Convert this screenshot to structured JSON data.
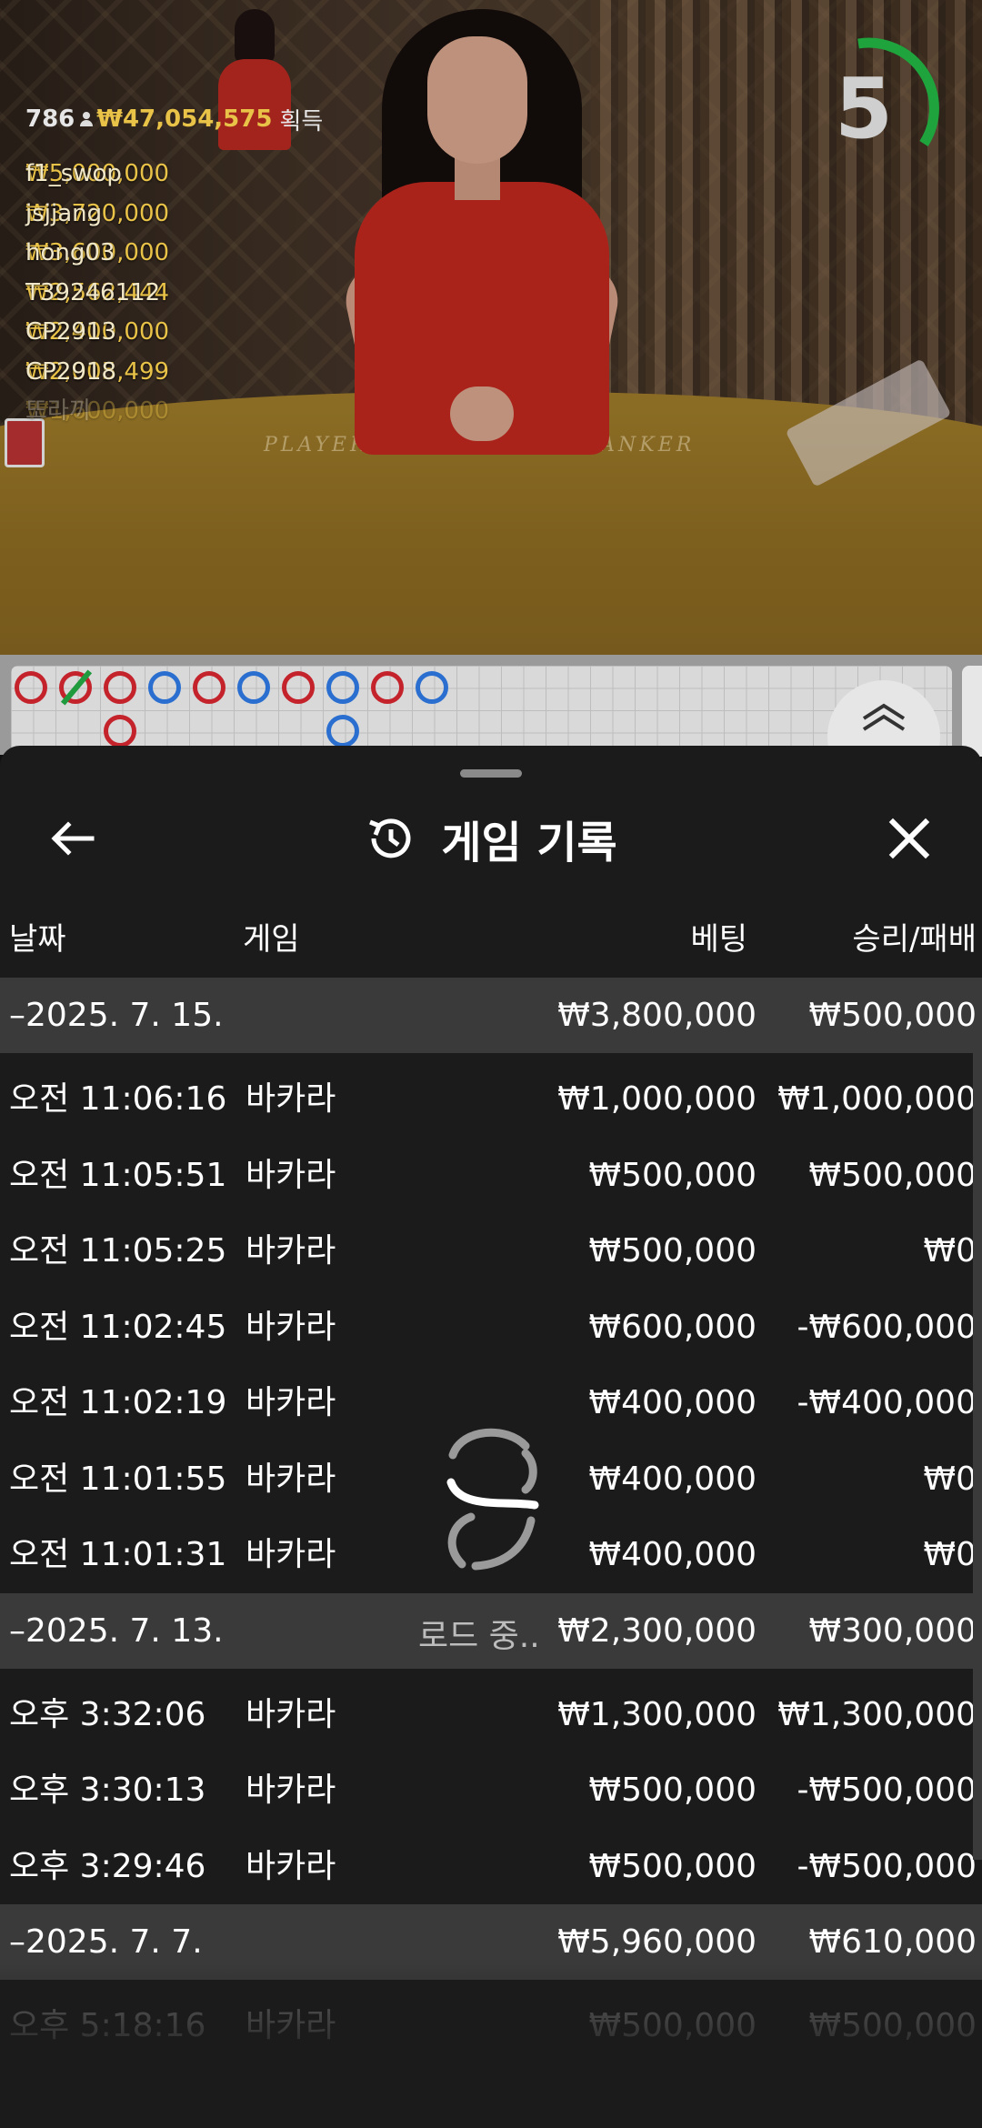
{
  "timer": {
    "value": "5"
  },
  "winners": {
    "count": "786",
    "total": "₩47,054,575",
    "gain_label": "획득",
    "list": [
      {
        "amount": "₩5,000,000",
        "name": "f1_swop"
      },
      {
        "amount": "₩3,720,000",
        "name": "jsjjang"
      },
      {
        "amount": "₩3,600,000",
        "name": "hong03"
      },
      {
        "amount": "₩2,562,444",
        "name": "T39246112"
      },
      {
        "amount": "₩2,400,000",
        "name": "CP2913"
      },
      {
        "amount": "₩2,005,499",
        "name": "CP2918"
      },
      {
        "amount": "₩1,600,000",
        "name": "또라끼"
      }
    ]
  },
  "table_labels": {
    "player": "PLAYER",
    "banker": "BANKER"
  },
  "sheet": {
    "title": "게임 기록",
    "columns": {
      "date": "날짜",
      "game": "게임",
      "bet": "베팅",
      "result": "승리/패배"
    },
    "loading": "로드 중..",
    "groups": [
      {
        "date": "–2025. 7. 15.",
        "bet": "₩3,800,000",
        "result": "₩500,000",
        "rows": [
          {
            "time": "오전 11:06:16",
            "game": "바카라",
            "bet": "₩1,000,000",
            "result": "₩1,000,000"
          },
          {
            "time": "오전 11:05:51",
            "game": "바카라",
            "bet": "₩500,000",
            "result": "₩500,000"
          },
          {
            "time": "오전 11:05:25",
            "game": "바카라",
            "bet": "₩500,000",
            "result": "₩0"
          },
          {
            "time": "오전 11:02:45",
            "game": "바카라",
            "bet": "₩600,000",
            "result": "-₩600,000"
          },
          {
            "time": "오전 11:02:19",
            "game": "바카라",
            "bet": "₩400,000",
            "result": "-₩400,000"
          },
          {
            "time": "오전 11:01:55",
            "game": "바카라",
            "bet": "₩400,000",
            "result": "₩0"
          },
          {
            "time": "오전 11:01:31",
            "game": "바카라",
            "bet": "₩400,000",
            "result": "₩0"
          }
        ]
      },
      {
        "date": "–2025. 7. 13.",
        "bet": "₩2,300,000",
        "result": "₩300,000",
        "rows": [
          {
            "time": "오후 3:32:06",
            "game": "바카라",
            "bet": "₩1,300,000",
            "result": "₩1,300,000"
          },
          {
            "time": "오후 3:30:13",
            "game": "바카라",
            "bet": "₩500,000",
            "result": "-₩500,000"
          },
          {
            "time": "오후 3:29:46",
            "game": "바카라",
            "bet": "₩500,000",
            "result": "-₩500,000"
          }
        ]
      },
      {
        "date": "–2025. 7. 7.",
        "bet": "₩5,960,000",
        "result": "₩610,000",
        "rows": [
          {
            "time": "오후 5:18:16",
            "game": "바카라",
            "bet": "₩500,000",
            "result": "₩500,000"
          }
        ]
      }
    ]
  },
  "colors": {
    "banker": "#c4232b",
    "player": "#2a6fd0",
    "tie": "#1f9a3d",
    "gold": "#e9c248",
    "timer_arc": "#1fa33c"
  }
}
